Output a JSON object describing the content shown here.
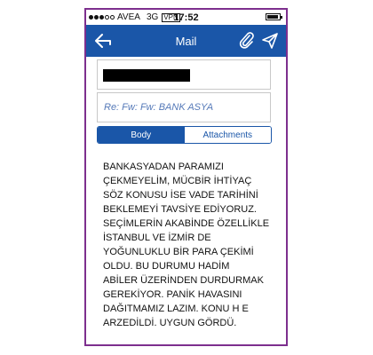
{
  "status_bar": {
    "carrier": "AVEA",
    "network": "3G",
    "vpn": "VPN",
    "time": "17:52"
  },
  "nav": {
    "title": "Mail",
    "bar_color": "#1a56a8"
  },
  "from_field": {
    "value_redacted": true
  },
  "subject": {
    "text": "Re: Fw: Fw:  BANK ASYA"
  },
  "tabs": [
    {
      "label": "Body",
      "selected": true
    },
    {
      "label": "Attachments",
      "selected": false
    }
  ],
  "body": {
    "lines": [
      "BANKASYADAN PARAMIZI",
      "ÇEKMEYELİM, MÜCBİR İHTİYAÇ",
      "SÖZ KONUSU İSE VADE TARİHİNİ",
      "BEKLEMEYİ TAVSİYE EDİYORUZ.",
      "SEÇİMLERİN AKABİNDE ÖZELLİKLE",
      "İSTANBUL VE İZMİR DE",
      "YOĞUNLUKLU BİR PARA ÇEKİMİ",
      "OLDU. BU DURUMU HADİM",
      "ABİLER ÜZERİNDEN DURDURMAK",
      "GEREKİYOR. PANİK HAVASINI",
      "DAĞITMAMIZ LAZIM. KONU H E",
      "ARZEDİLDİ. UYGUN GÖRDÜ."
    ]
  }
}
